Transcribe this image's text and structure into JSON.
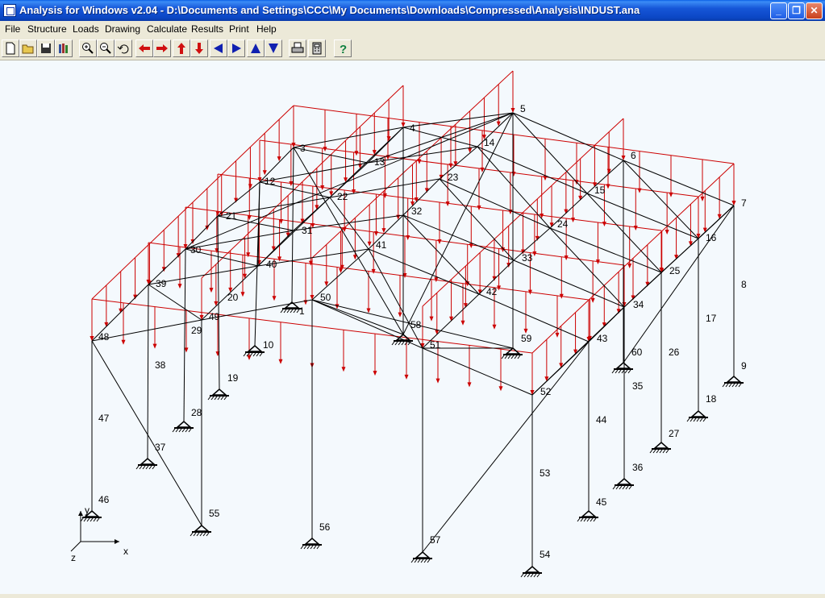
{
  "window": {
    "title": "Analysis for Windows v2.04 - D:\\Documents and Settings\\CCC\\My Documents\\Downloads\\Compressed\\Analysis\\INDUST.ana"
  },
  "menu": {
    "items": [
      "File",
      "Structure",
      "Loads",
      "Drawing",
      "Calculate",
      "Results",
      "Print",
      "Help"
    ]
  },
  "toolbar": {
    "icons": [
      "new-file-icon",
      "open-folder-icon",
      "save-icon",
      "library-icon",
      "zoom-in-icon",
      "zoom-out-icon",
      "undo-icon",
      "pan-left-icon",
      "pan-right-icon",
      "pan-up-icon",
      "pan-down-icon",
      "rotate-left-icon",
      "rotate-right-icon",
      "rotate-up-icon",
      "rotate-down-icon",
      "print-icon",
      "calculator-icon",
      "help-icon"
    ]
  },
  "colors": {
    "structure": "#000000",
    "load": "#cc0000",
    "canvas": "#f4f9fd"
  },
  "axes": {
    "x": "x",
    "y": "y",
    "z": "z"
  },
  "nodes": [
    {
      "id": "1",
      "n": "1"
    },
    {
      "id": "3",
      "n": "3"
    },
    {
      "id": "4",
      "n": "4"
    },
    {
      "id": "5",
      "n": "5"
    },
    {
      "id": "6",
      "n": "6"
    },
    {
      "id": "7",
      "n": "7"
    },
    {
      "id": "8",
      "n": "8"
    },
    {
      "id": "9",
      "n": "9"
    },
    {
      "id": "10",
      "n": "10"
    },
    {
      "id": "12",
      "n": "12"
    },
    {
      "id": "13",
      "n": "13"
    },
    {
      "id": "14",
      "n": "14"
    },
    {
      "id": "15",
      "n": "15"
    },
    {
      "id": "16",
      "n": "16"
    },
    {
      "id": "17",
      "n": "17"
    },
    {
      "id": "18",
      "n": "18"
    },
    {
      "id": "19",
      "n": "19"
    },
    {
      "id": "20",
      "n": "20"
    },
    {
      "id": "21",
      "n": "21"
    },
    {
      "id": "22",
      "n": "22"
    },
    {
      "id": "23",
      "n": "23"
    },
    {
      "id": "24",
      "n": "24"
    },
    {
      "id": "25",
      "n": "25"
    },
    {
      "id": "26",
      "n": "26"
    },
    {
      "id": "27",
      "n": "27"
    },
    {
      "id": "28",
      "n": "28"
    },
    {
      "id": "29",
      "n": "29"
    },
    {
      "id": "30",
      "n": "30"
    },
    {
      "id": "31",
      "n": "31"
    },
    {
      "id": "32",
      "n": "32"
    },
    {
      "id": "33",
      "n": "33"
    },
    {
      "id": "34",
      "n": "34"
    },
    {
      "id": "35",
      "n": "35"
    },
    {
      "id": "36",
      "n": "36"
    },
    {
      "id": "37",
      "n": "37"
    },
    {
      "id": "38",
      "n": "38"
    },
    {
      "id": "39",
      "n": "39"
    },
    {
      "id": "40",
      "n": "40"
    },
    {
      "id": "41",
      "n": "41"
    },
    {
      "id": "42",
      "n": "42"
    },
    {
      "id": "43",
      "n": "43"
    },
    {
      "id": "44",
      "n": "44"
    },
    {
      "id": "45",
      "n": "45"
    },
    {
      "id": "46",
      "n": "46"
    },
    {
      "id": "47",
      "n": "47"
    },
    {
      "id": "48",
      "n": "48"
    },
    {
      "id": "49",
      "n": "49"
    },
    {
      "id": "50",
      "n": "50"
    },
    {
      "id": "51",
      "n": "51"
    },
    {
      "id": "52",
      "n": "52"
    },
    {
      "id": "53",
      "n": "53"
    },
    {
      "id": "54",
      "n": "54"
    },
    {
      "id": "55",
      "n": "55"
    },
    {
      "id": "56",
      "n": "56"
    },
    {
      "id": "57",
      "n": "57"
    },
    {
      "id": "58",
      "n": "58"
    },
    {
      "id": "59",
      "n": "59"
    },
    {
      "id": "60",
      "n": "60"
    }
  ]
}
